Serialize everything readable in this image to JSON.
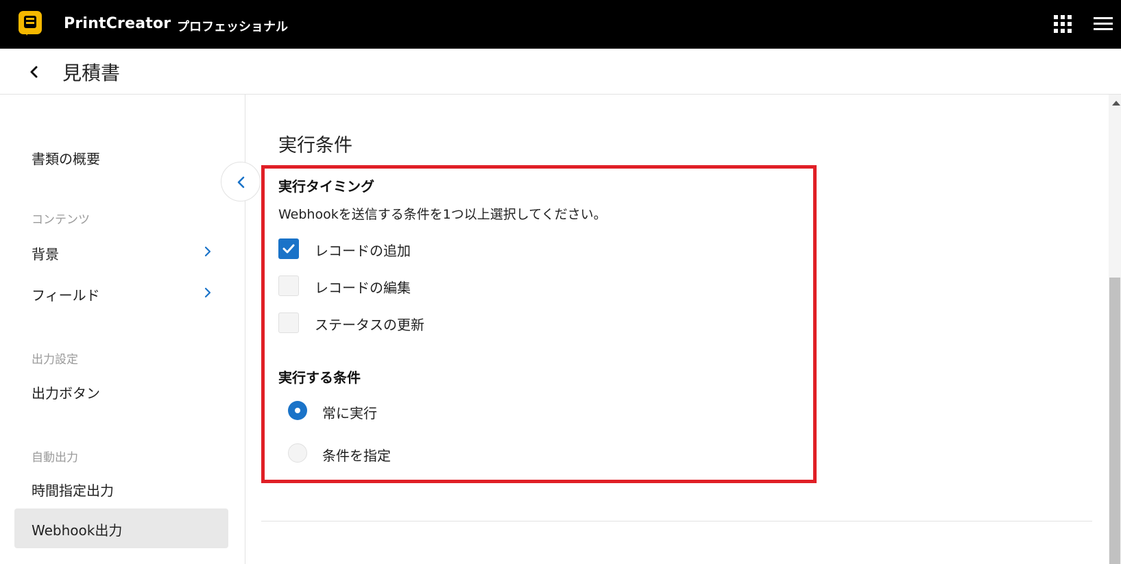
{
  "header": {
    "app_name": "PrintCreator",
    "edition": "プロフェッショナル",
    "icons": [
      "app-logo-icon",
      "apps-grid-icon",
      "hamburger-menu-icon"
    ]
  },
  "titlebar": {
    "title": "見積書"
  },
  "sidebar": {
    "overview": "書類の概要",
    "sections": {
      "content": "コンテンツ",
      "output_settings": "出力設定",
      "auto_output": "自動出力"
    },
    "items": {
      "background": "背景",
      "fields": "フィールド",
      "output_button": "出力ボタン",
      "scheduled_output": "時間指定出力",
      "webhook_output": "Webhook出力"
    },
    "active_item": "Webhook出力"
  },
  "main": {
    "section_title": "実行条件",
    "timing": {
      "heading": "実行タイミング",
      "description": "Webhookを送信する条件を1つ以上選択してください。",
      "options": [
        {
          "label": "レコードの追加",
          "checked": true
        },
        {
          "label": "レコードの編集",
          "checked": false
        },
        {
          "label": "ステータスの更新",
          "checked": false
        }
      ]
    },
    "condition": {
      "heading": "実行する条件",
      "options": [
        {
          "label": "常に実行",
          "selected": true
        },
        {
          "label": "条件を指定",
          "selected": false
        }
      ]
    }
  },
  "colors": {
    "accent": "#1a73c8",
    "highlight_border": "#e01f26",
    "logo": "#f5b800",
    "topbar": "#000000"
  }
}
